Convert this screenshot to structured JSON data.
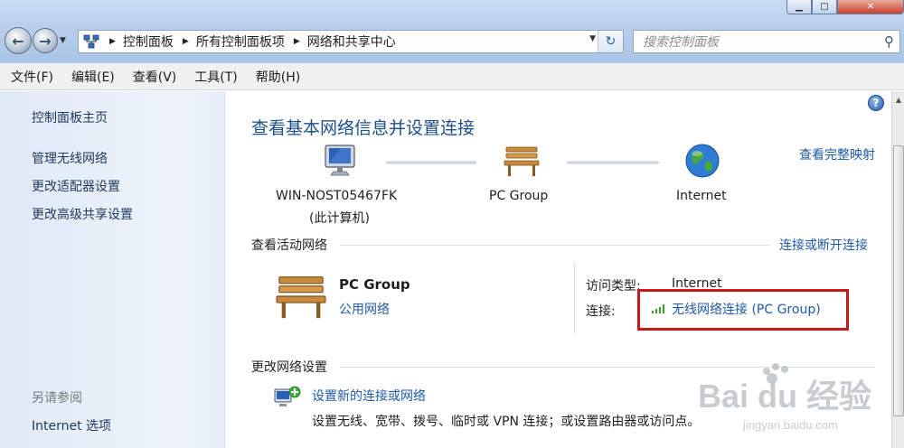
{
  "window": {
    "min_label": "▁",
    "max_label": "□",
    "close_label": "✕"
  },
  "address": {
    "crumbs": [
      "控制面板",
      "所有控制面板项",
      "网络和共享中心"
    ],
    "search_placeholder": "搜索控制面板"
  },
  "menubar": {
    "items": [
      "文件(F)",
      "编辑(E)",
      "查看(V)",
      "工具(T)",
      "帮助(H)"
    ]
  },
  "sidebar": {
    "home": "控制面板主页",
    "links": [
      "管理无线网络",
      "更改适配器设置",
      "更改高级共享设置"
    ],
    "see_also_heading": "另请参阅",
    "see_also_links": [
      "Internet 选项"
    ]
  },
  "main": {
    "help": "?",
    "title": "查看基本网络信息并设置连接",
    "full_map_link": "查看完整映射",
    "map": {
      "computer_name": "WIN-NOST05467FK",
      "computer_sub": "(此计算机)",
      "network_name": "PC Group",
      "internet_name": "Internet"
    },
    "active_section": {
      "title": "查看活动网络",
      "link": "连接或断开连接",
      "network_name": "PC Group",
      "network_type": "公用网络",
      "access_type_label": "访问类型:",
      "access_type_value": "Internet",
      "connection_label": "连接:",
      "connection_value": "无线网络连接 (PC Group)"
    },
    "change_section": {
      "title": "更改网络设置",
      "task_link": "设置新的连接或网络",
      "task_desc": "设置无线、宽带、拨号、临时或 VPN 连接；或设置路由器或访问点。"
    }
  },
  "watermark": {
    "brand": "Bai du 经验",
    "url": "jingyan.baidu.com"
  },
  "colors": {
    "link": "#1e5aa8",
    "title": "#1e4f8c",
    "highlight": "#c81818"
  }
}
